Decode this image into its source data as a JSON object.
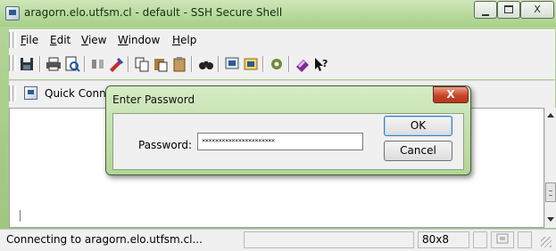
{
  "window": {
    "title": "aragorn.elo.utfsm.cl - default - SSH Secure Shell",
    "close_symbol": "X"
  },
  "menu": [
    {
      "label": "File",
      "mnemonic": "F",
      "rest": "ile"
    },
    {
      "label": "Edit",
      "mnemonic": "E",
      "rest": "dit"
    },
    {
      "label": "View",
      "mnemonic": "V",
      "rest": "iew"
    },
    {
      "label": "Window",
      "mnemonic": "W",
      "rest": "indow"
    },
    {
      "label": "Help",
      "mnemonic": "H",
      "rest": "elp"
    }
  ],
  "toolbar": {
    "icons": [
      "save-icon",
      "print-icon",
      "print-preview-icon",
      "disconnect-icon",
      "settings-icon",
      "copy-icon",
      "paste-icon",
      "paste-clipboard-icon",
      "find-icon",
      "new-terminal-icon",
      "new-file-transfer-icon",
      "profiles-icon",
      "help-book-icon",
      "context-help-icon"
    ]
  },
  "quickbar": {
    "quick_connect_label": "Quick Conn"
  },
  "dialog": {
    "title": "Enter Password",
    "close_symbol": "X",
    "password_label": "Password:",
    "password_value": "××××××××××××××××××××××",
    "ok_label": "OK",
    "cancel_label": "Cancel"
  },
  "status": {
    "message": "Connecting to aragorn.elo.utfsm.cl...",
    "terminal_size": "80x8"
  },
  "colors": {
    "titlebar": "#b5d99a",
    "close_button": "#c8442a",
    "dialog_frame": "#b2d695"
  }
}
